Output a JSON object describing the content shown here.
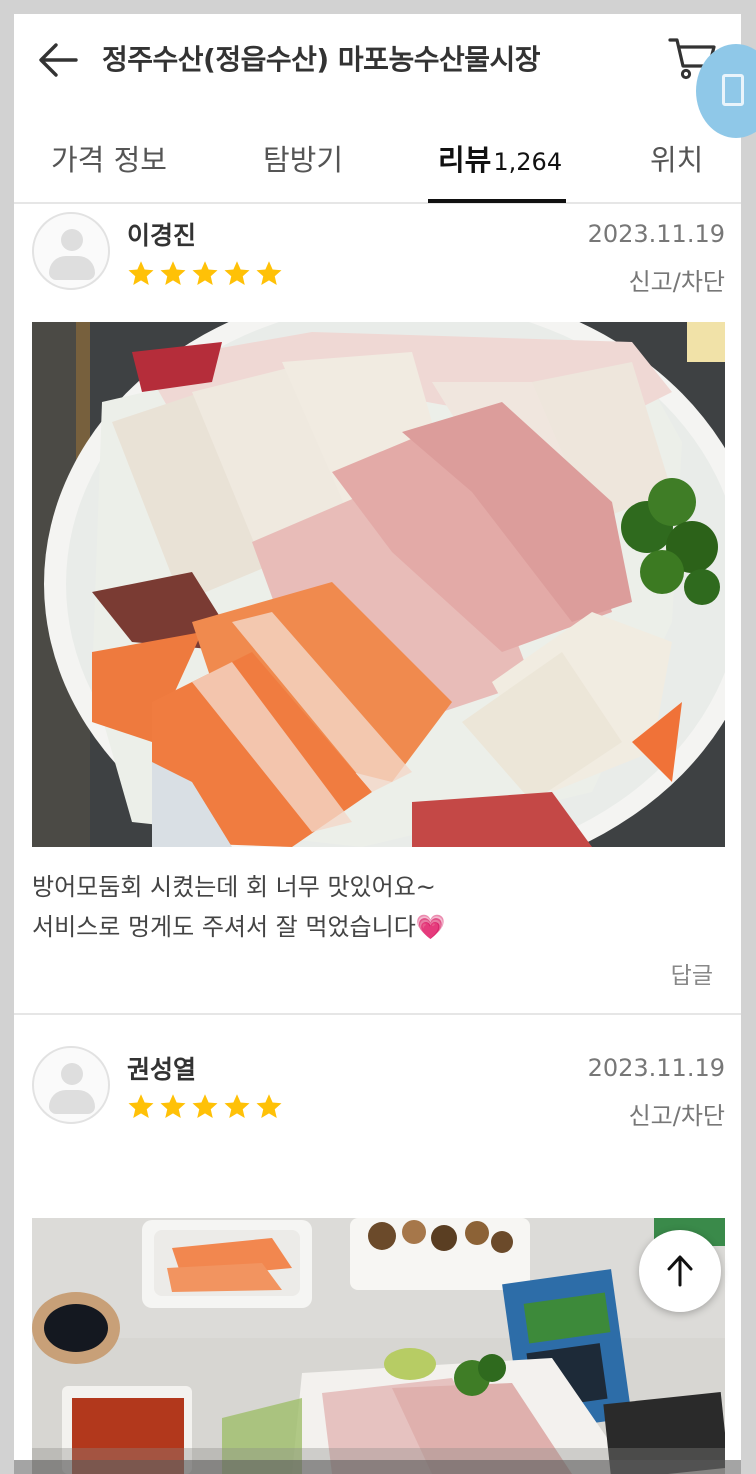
{
  "header": {
    "title": "정주수산(정읍수산) 마포농수산물시장",
    "back_icon": "arrow-left-icon",
    "cart_icon": "cart-icon"
  },
  "tabs": [
    {
      "label": "가격 정보",
      "active": false
    },
    {
      "label": "탐방기",
      "active": false
    },
    {
      "label": "리뷰",
      "count": "1,264",
      "active": true
    },
    {
      "label": "위치",
      "active": false
    }
  ],
  "reviews": [
    {
      "name": "이경진",
      "rating": 5,
      "date": "2023.11.19",
      "report_label": "신고/차단",
      "photo_alt": "회 모둠 접시",
      "text_lines": [
        "방어모둠회 시켰는데 회 너무 맛있어요~",
        "서비스로 멍게도 주셔서 잘 먹었습니다"
      ],
      "emoji": "💗",
      "reply_label": "답글"
    },
    {
      "name": "권성열",
      "rating": 5,
      "date": "2023.11.19",
      "report_label": "신고/차단",
      "photo_alt": "연어회와 방어회, 김"
    }
  ],
  "colors": {
    "star": "#ffc107",
    "text_primary": "#333333",
    "text_secondary": "#777777",
    "divider": "#e6e6e6",
    "page_bg": "#d2d2d2"
  },
  "scroll_top_icon": "arrow-up-icon"
}
